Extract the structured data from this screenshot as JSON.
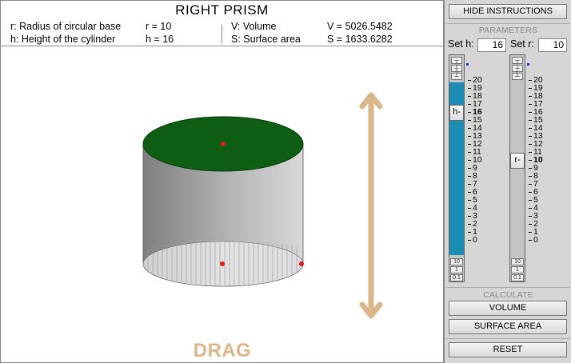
{
  "app": {
    "title": "RIGHT PRISM"
  },
  "info": {
    "r_desc": "r: Radius of circular base",
    "h_desc": "h: Height of the cylinder",
    "r_val": "r = 10",
    "h_val": "h = 16",
    "v_desc": "V: Volume",
    "s_desc": "S: Surface area",
    "v_val": "V = 5026.5482",
    "s_val": "S = 1633.6282"
  },
  "scene": {
    "drag_label": "DRAG",
    "colors": {
      "top_face": "#0d5e12",
      "side_dark": "#808080",
      "side_light": "#d0d0d0",
      "point": "#e8131b",
      "arrow": "#dbb68a"
    }
  },
  "panel": {
    "hide_instructions": "HIDE INSTRUCTIONS",
    "parameters_heading": "PARAMETERS",
    "set_h_label": "Set h:",
    "set_h_value": "16",
    "set_r_label": "Set r:",
    "set_r_value": "10",
    "calculate_heading": "CALCULATE",
    "volume_button": "VOLUME",
    "surface_area_button": "SURFACE AREA",
    "reset_button": "RESET"
  },
  "sliders": {
    "min": 0,
    "max": 20,
    "h": {
      "value": 16,
      "thumb_label": "h-",
      "step_labels": [
        "10",
        "1",
        "0.1"
      ]
    },
    "r": {
      "value": 10,
      "thumb_label": "r-",
      "step_labels": [
        "10",
        "1",
        "0.1"
      ]
    },
    "scale_labels": [
      "20",
      "19",
      "18",
      "17",
      "16",
      "15",
      "14",
      "13",
      "12",
      "11",
      "10",
      "9",
      "8",
      "7",
      "6",
      "5",
      "4",
      "3",
      "2",
      "1",
      "0"
    ]
  },
  "accent": "#1b8db3"
}
